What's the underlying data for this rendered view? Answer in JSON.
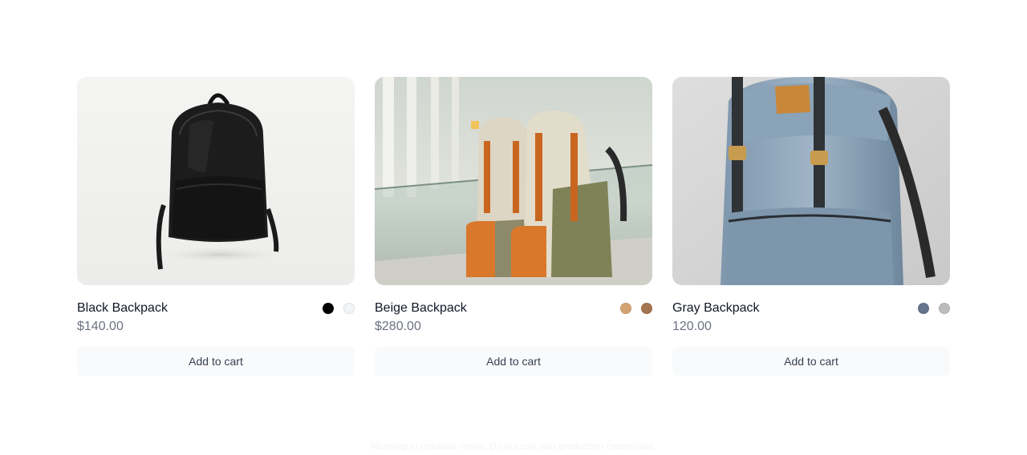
{
  "products": [
    {
      "name": "Black Backpack",
      "price": "$140.00",
      "button_label": "Add to cart",
      "image_subject": "black backpack on white studio background",
      "swatches": [
        {
          "color": "#000000"
        },
        {
          "color": "#f3f4f6"
        }
      ]
    },
    {
      "name": "Beige Backpack",
      "price": "$280.00",
      "button_label": "Add to cart",
      "image_subject": "beige and olive backpacks in airport terminal",
      "swatches": [
        {
          "color": "#d4a373"
        },
        {
          "color": "#a47551"
        }
      ]
    },
    {
      "name": "Gray Backpack",
      "price": "120.00",
      "button_label": "Add to cart",
      "image_subject": "gray-blue backpack with brown patches",
      "swatches": [
        {
          "color": "#64748b"
        },
        {
          "color": "#bdbdbd"
        }
      ]
    }
  ],
  "footer": {
    "note": "Running in emulator mode. Do not use with production credentials."
  }
}
